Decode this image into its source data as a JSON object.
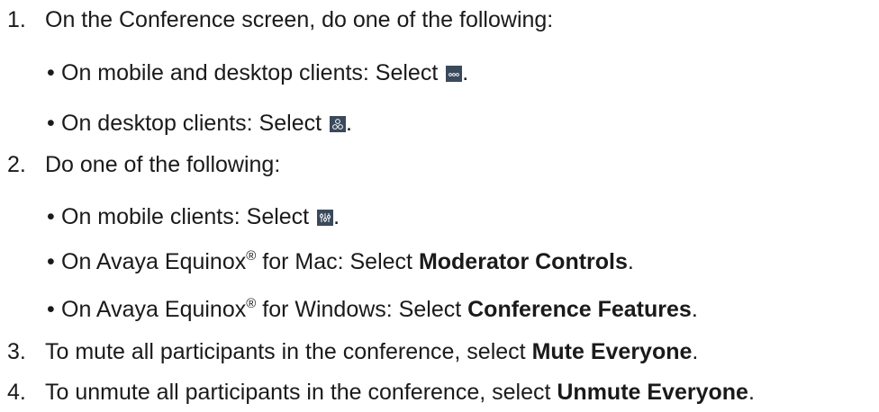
{
  "steps": [
    {
      "number": "1.",
      "text": "On the Conference screen, do one of the following:",
      "bullets": [
        {
          "bullet": "•",
          "text": "On mobile and desktop clients: Select ",
          "icon": "more-options-icon",
          "after": "."
        },
        {
          "bullet": "•",
          "text": "On desktop clients: Select ",
          "icon": "participants-icon",
          "after": "."
        }
      ]
    },
    {
      "number": "2.",
      "text": "Do one of the following:",
      "bullets": [
        {
          "bullet": "•",
          "text": "On mobile clients: Select ",
          "icon": "controls-icon",
          "after": "."
        },
        {
          "bullet": "•",
          "pre": "On Avaya Equinox",
          "sup": "®",
          "mid": " for Mac: Select ",
          "bold": "Moderator Controls",
          "after": "."
        },
        {
          "bullet": "•",
          "pre": "On Avaya Equinox",
          "sup": "®",
          "mid": " for Windows: Select ",
          "bold": "Conference Features",
          "after": "."
        }
      ]
    },
    {
      "number": "3.",
      "text": "To mute all participants in the conference, select ",
      "bold": "Mute Everyone",
      "after": "."
    },
    {
      "number": "4.",
      "text": "To unmute all participants in the conference, select ",
      "bold": "Unmute Everyone",
      "after": "."
    }
  ],
  "colors": {
    "text": "#1a1a1a",
    "icon_bg": "#3a4a5c"
  }
}
